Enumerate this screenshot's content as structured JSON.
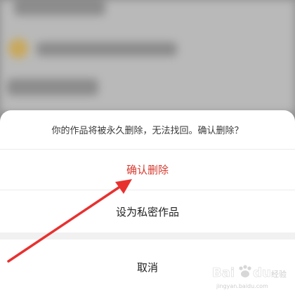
{
  "sheet": {
    "message": "你的作品将被永久删除，无法找回。确认删除？",
    "confirm_label": "确认删除",
    "private_label": "设为私密作品",
    "cancel_label": "取消"
  },
  "colors": {
    "danger": "#d63a2f",
    "annotation_arrow": "#e8312f"
  },
  "watermark": {
    "logo_text": "Bai du 经验",
    "url": "jingyan.baidu.com"
  }
}
